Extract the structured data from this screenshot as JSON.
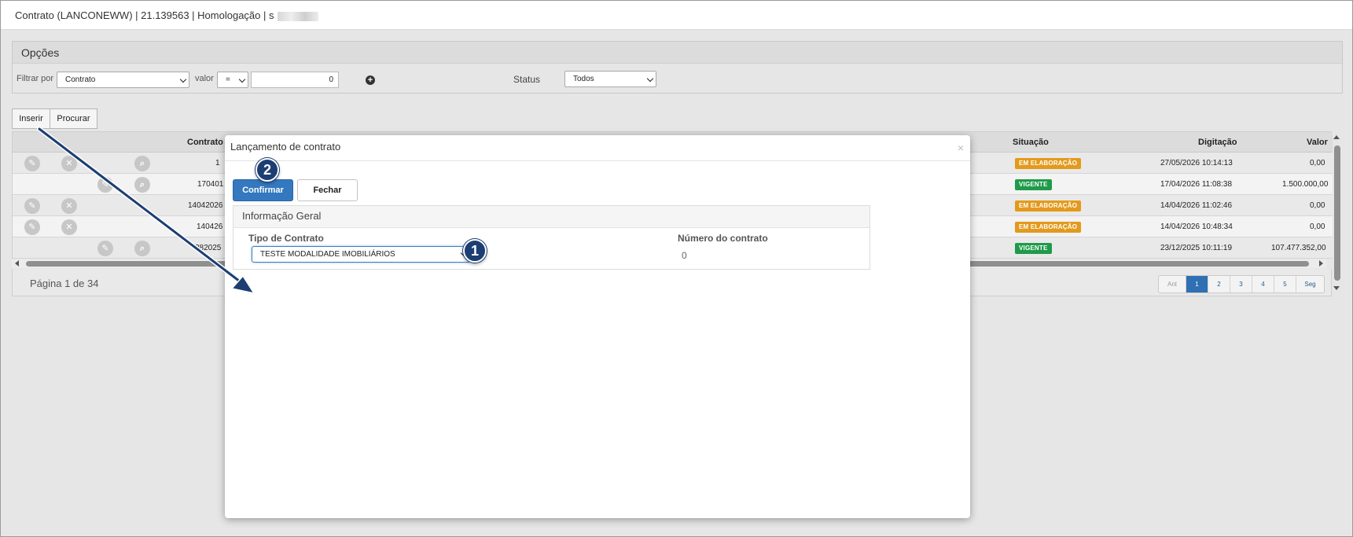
{
  "window": {
    "title": "Contrato (LANCONEWW) | 21.139563 | Homologação | s"
  },
  "options": {
    "header": "Opções",
    "filter_label": "Filtrar por",
    "filter_value": "Contrato",
    "valor_label": "valor",
    "operator_value": "=",
    "input_value": "0",
    "status_label": "Status",
    "status_value": "Todos"
  },
  "toolbar": {
    "insert_label": "Inserir",
    "search_label": "Procurar"
  },
  "grid": {
    "columns": {
      "contrato": "Contrato",
      "situacao": "Situação",
      "digitacao": "Digitação",
      "valor": "Valor"
    },
    "rows": [
      {
        "contrato": "1",
        "situacao": "EM ELABORAÇÃO",
        "digitacao": "27/05/2026 10:14:13",
        "valor": "0,00"
      },
      {
        "contrato": "170401",
        "situacao": "VIGENTE",
        "digitacao": "17/04/2026 11:08:38",
        "valor": "1.500.000,00"
      },
      {
        "contrato": "14042026",
        "situacao": "EM ELABORAÇÃO",
        "digitacao": "14/04/2026 11:02:46",
        "valor": "0,00"
      },
      {
        "contrato": "140426",
        "situacao": "EM ELABORAÇÃO",
        "digitacao": "14/04/2026 10:48:34",
        "valor": "0,00"
      },
      {
        "contrato": "282025",
        "situacao": "VIGENTE",
        "digitacao": "23/12/2025 10:11:19",
        "valor": "107.477.352,00"
      }
    ]
  },
  "pagination": {
    "info": "Página 1 de 34",
    "prev": "Ant",
    "pages": [
      "1",
      "2",
      "3",
      "4",
      "5"
    ],
    "next": "Seg",
    "current": 1
  },
  "modal": {
    "title": "Lançamento de contrato",
    "close_symbol": "×",
    "confirm_label": "Confirmar",
    "close_label": "Fechar",
    "section_title": "Informação Geral",
    "tipo_label": "Tipo de Contrato",
    "tipo_value": "TESTE MODALIDADE IMOBILIÁRIOS",
    "numero_label": "Número do contrato",
    "numero_value": "0"
  },
  "steps": [
    "1",
    "2"
  ],
  "colors": {
    "primary": "#3478bf",
    "badge_elaboracao": "#e39a1c",
    "badge_vigente": "#1f9a4a",
    "step_marker": "#1d3e72"
  },
  "icons": [
    "edit-icon",
    "delete-icon",
    "search-icon",
    "plus-icon",
    "close-icon"
  ]
}
